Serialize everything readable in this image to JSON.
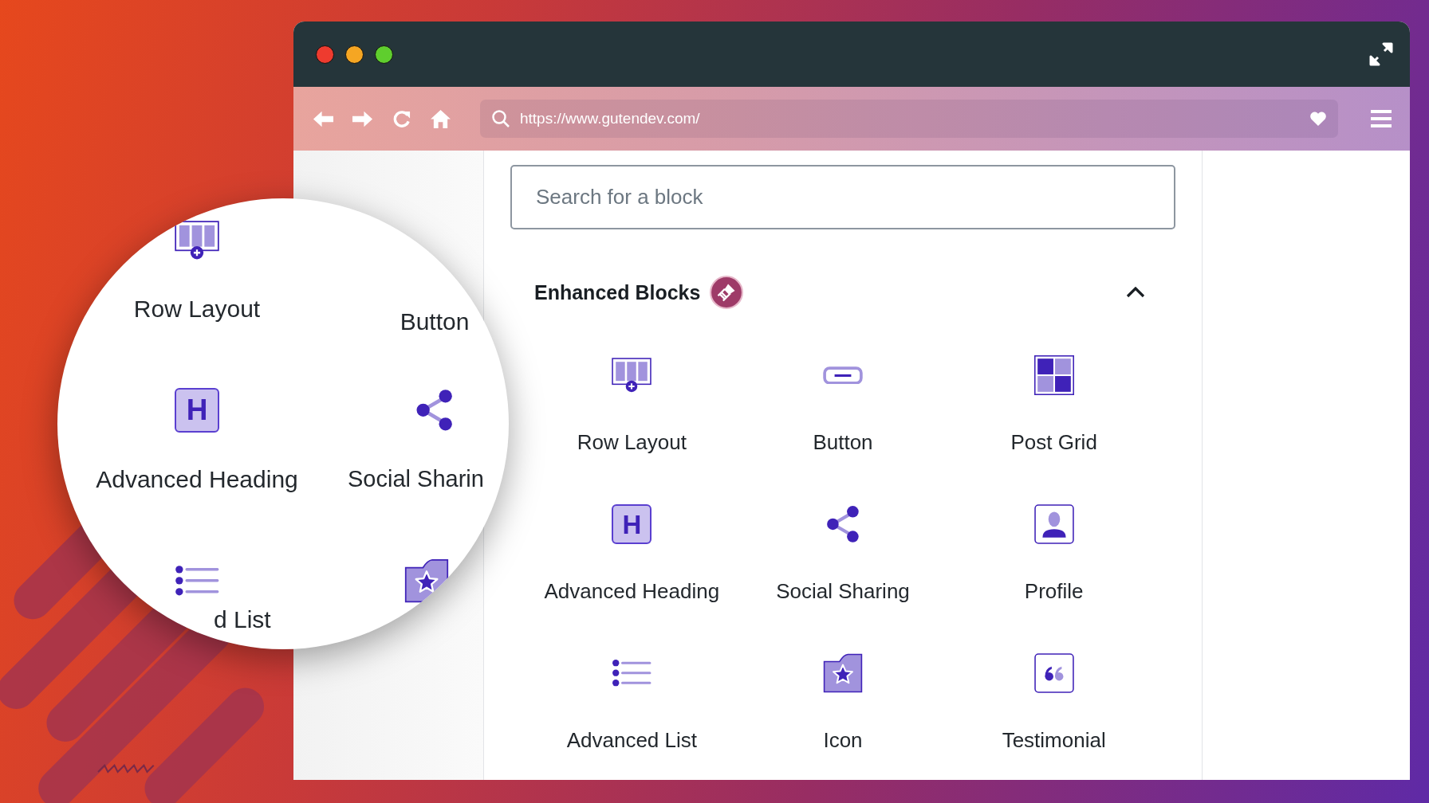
{
  "window": {
    "url": "https://www.gutendev.com/"
  },
  "search": {
    "placeholder": "Search for a block"
  },
  "section": {
    "title": "Enhanced Blocks",
    "expanded": true
  },
  "blocks": [
    {
      "kind": "row-layout",
      "label": "Row Layout"
    },
    {
      "kind": "button",
      "label": "Button"
    },
    {
      "kind": "post-grid",
      "label": "Post Grid"
    },
    {
      "kind": "heading",
      "glyph": "H",
      "label": "Advanced Heading"
    },
    {
      "kind": "share",
      "label": "Social Sharing"
    },
    {
      "kind": "profile",
      "label": "Profile"
    },
    {
      "kind": "list",
      "label": "Advanced List"
    },
    {
      "kind": "icon",
      "label": "Icon"
    },
    {
      "kind": "testimonial",
      "label": "Testimonial"
    }
  ],
  "magnifier": {
    "items": [
      {
        "kind": "row-layout",
        "label": "Row Layout"
      },
      {
        "label": "Button"
      },
      {
        "kind": "heading",
        "glyph": "H",
        "label": "Advanced Heading"
      },
      {
        "kind": "share",
        "label": "Social Sharin"
      },
      {
        "kind": "list",
        "label": "d List"
      },
      {
        "kind": "icon"
      }
    ]
  }
}
